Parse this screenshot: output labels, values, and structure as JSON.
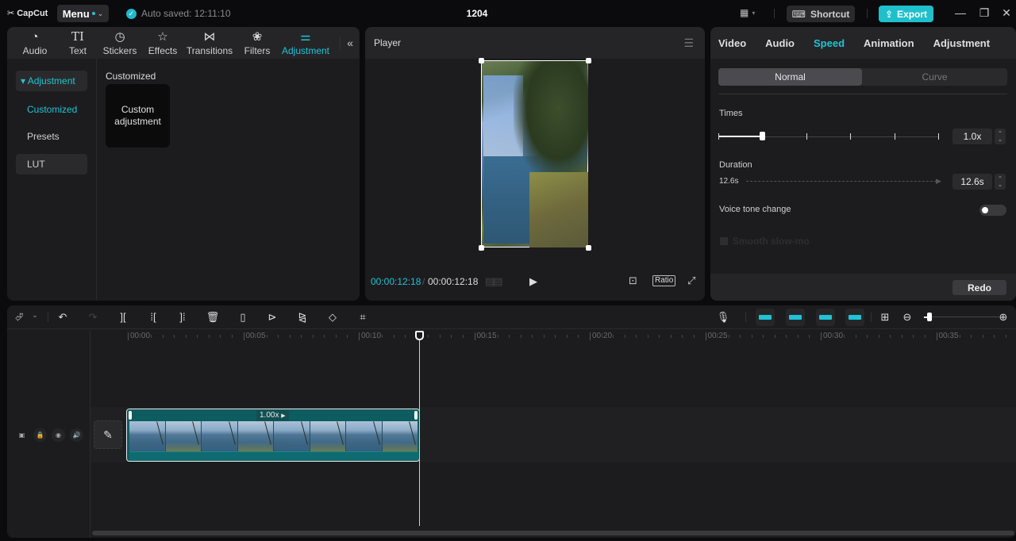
{
  "app": {
    "logo": "CapCut",
    "menu_label": "Menu",
    "autosave": "Auto saved: 12:11:10",
    "project_title": "1204",
    "shortcut_label": "Shortcut",
    "export_label": "Export"
  },
  "media_panel": {
    "tabs": [
      {
        "label": "Audio",
        "icon": "audio-icon"
      },
      {
        "label": "Text",
        "icon": "text-icon"
      },
      {
        "label": "Stickers",
        "icon": "stickers-icon"
      },
      {
        "label": "Effects",
        "icon": "effects-icon"
      },
      {
        "label": "Transitions",
        "icon": "transitions-icon"
      },
      {
        "label": "Filters",
        "icon": "filters-icon"
      },
      {
        "label": "Adjustment",
        "icon": "adjustment-icon",
        "active": true
      }
    ],
    "sidebar": [
      {
        "label": "▾ Adjustment"
      },
      {
        "label": "Customized"
      },
      {
        "label": "Presets"
      },
      {
        "label": "LUT"
      }
    ],
    "section_label": "Customized",
    "card_label": "Custom adjustment"
  },
  "player": {
    "title": "Player",
    "current_time": "00:00:12:18",
    "separator": "/",
    "total_time": "00:00:12:18",
    "ratio_label": "Ratio"
  },
  "properties": {
    "tabs": [
      "Video",
      "Audio",
      "Speed",
      "Animation",
      "Adjustment"
    ],
    "active_tab": "Speed",
    "mode_normal": "Normal",
    "mode_curve": "Curve",
    "times_label": "Times",
    "times_value": "1.0x",
    "times_slider_fraction": 0.2,
    "duration_label": "Duration",
    "duration_original": "12.6s",
    "duration_value": "12.6s",
    "voice_tone_label": "Voice tone change",
    "voice_tone_on": false,
    "smooth_label": "Smooth slow-mo",
    "redo_label": "Redo"
  },
  "timeline": {
    "ruler": [
      "00:00",
      "00:05",
      "00:10",
      "00:15",
      "00:20",
      "00:25",
      "00:30",
      "00:35"
    ],
    "clip_speed": "1.00x",
    "zoom_fraction": 0.1,
    "colors": {
      "accent": "#1fc4d4",
      "clip": "#0f5b5e"
    }
  }
}
